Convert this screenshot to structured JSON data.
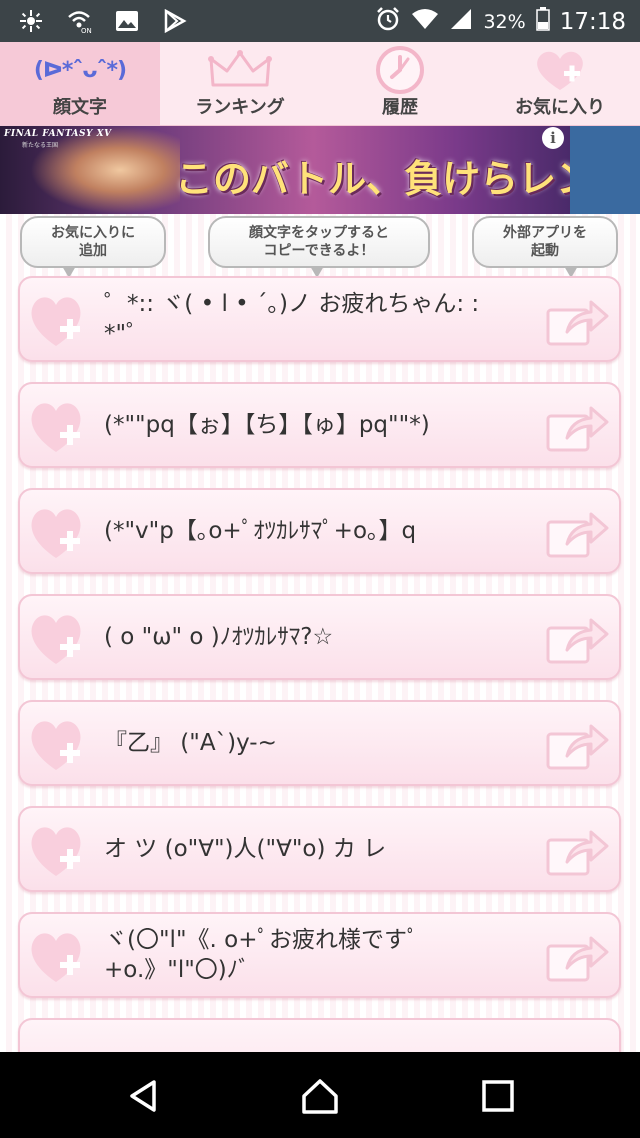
{
  "status_bar": {
    "battery_percent": "32%",
    "time": "17:18",
    "icons": [
      "settings-gear-icon",
      "wifi-calling-icon",
      "image-icon",
      "play-store-icon",
      "alarm-icon",
      "wifi-icon",
      "signal-icon",
      "battery-icon"
    ]
  },
  "tabs": [
    {
      "label": "顔文字",
      "icon": "(ᐅ*ˆᴗˆ*)",
      "active": true
    },
    {
      "label": "ランキング",
      "icon": "crown-icon",
      "active": false
    },
    {
      "label": "履歴",
      "icon": "clock-icon",
      "active": false
    },
    {
      "label": "お気に入り",
      "icon": "heart-plus-icon",
      "active": false
    }
  ],
  "ad": {
    "logo": "FINAL FANTASY XV",
    "logo_sub": "新たなる王国",
    "headline": "このバトル、負けらレン。",
    "info_label": "i"
  },
  "tips": {
    "favorite": "お気に入りに\n追加",
    "copy": "顔文字をタップすると\nコピーできるよ！",
    "external": "外部アプリを\n起動"
  },
  "emoticons": [
    "゜*:: ヾ( • l • ´｡)ノ お疲れちゃん: : *\"゜",
    "(*\"\"pq【ぉ】【ち】【ゅ】pq\"\"*)",
    "(*\"v\"p【｡o+ﾟｵﾂｶﾚｻﾏﾟ+o｡】q",
    "( o \"ω\" o )ﾉｵﾂｶﾚｻﾏ?☆",
    "『乙』 (\"A`)y-~",
    "オ ツ (o\"∀\")人(\"∀\"o) カ レ",
    "ヾ(〇\"l\"《. o+ﾟお疲れ様ですﾟ\n+o.》\"l\"〇)ﾉﾞ"
  ],
  "colors": {
    "status_bar": "#3c4448",
    "tab_bg": "#fde9ef",
    "tab_active": "#f6c9d7",
    "row_border": "#f3c6d5",
    "heart": "#f9cfdd"
  }
}
